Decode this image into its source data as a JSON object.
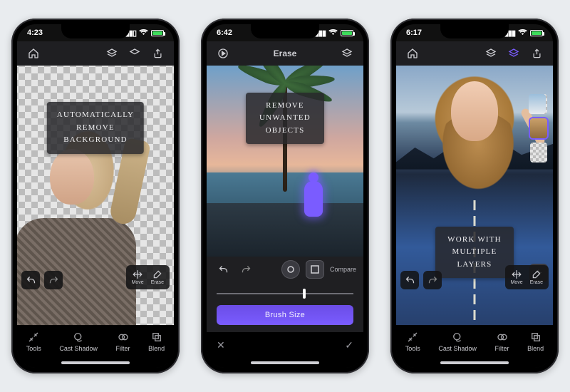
{
  "phone1": {
    "status_time": "4:23",
    "overlay_line1": "Automatically",
    "overlay_line2": "Remove Background",
    "mini": {
      "move": "Move",
      "erase": "Erase"
    },
    "bottom": {
      "tools": "Tools",
      "cast_shadow": "Cast Shadow",
      "filter": "Filter",
      "blend": "Blend"
    }
  },
  "phone2": {
    "status_time": "6:42",
    "title": "Erase",
    "overlay_line1": "Remove",
    "overlay_line2": "Unwanted Objects",
    "compare": "Compare",
    "brush_label": "Brush Size",
    "cancel": "✕",
    "confirm": "✓"
  },
  "phone3": {
    "status_time": "6:17",
    "overlay_line1": "Work with",
    "overlay_line2": "multiple Layers",
    "mini": {
      "move": "Move",
      "erase": "Erase"
    },
    "bottom": {
      "tools": "Tools",
      "cast_shadow": "Cast Shadow",
      "filter": "Filter",
      "blend": "Blend"
    }
  }
}
